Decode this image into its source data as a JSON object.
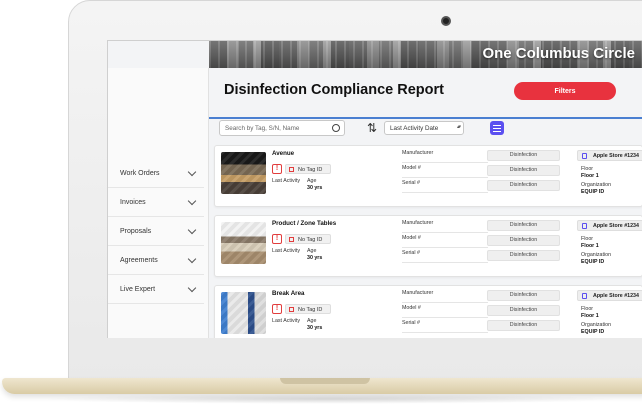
{
  "banner": {
    "title": "One Columbus Circle"
  },
  "sidebar": {
    "items": [
      {
        "label": "Work Orders"
      },
      {
        "label": "Invoices"
      },
      {
        "label": "Proposals"
      },
      {
        "label": "Agreements"
      },
      {
        "label": "Live Expert"
      }
    ]
  },
  "header": {
    "title": "Disinfection Compliance Report",
    "filters_label": "Filters"
  },
  "toolbar": {
    "search_placeholder": "Search by Tag, S/N, Name",
    "sort_value": "Last Activity Date"
  },
  "card_labels": {
    "no_tag": "No Tag ID",
    "last_activity": "Last Activity",
    "age": "Age",
    "manufacturer": "Manufacturer",
    "model": "Model #",
    "serial": "Serial #",
    "disinfection": "Disinfection",
    "floor": "Floor",
    "organization": "Organization"
  },
  "assets": [
    {
      "name": "Avenue",
      "age": "30 yrs",
      "store": "Apple Store #1234",
      "floor": "Floor 1",
      "org": "EQUIP ID"
    },
    {
      "name": "Product / Zone Tables",
      "age": "30 yrs",
      "store": "Apple Store #1234",
      "floor": "Floor 1",
      "org": "EQUIP ID"
    },
    {
      "name": "Break Area",
      "age": "30 yrs",
      "store": "Apple Store #1234",
      "floor": "Floor 1",
      "org": "EQUIP ID"
    }
  ],
  "colors": {
    "accent_red": "#e8323e",
    "accent_purple": "#5b4ff0",
    "divider_blue": "#4a7fd1"
  },
  "icons": [
    "search-icon",
    "sort-icon",
    "tune-icon",
    "alert-icon",
    "tag-icon",
    "store-icon",
    "chevron-down-icon"
  ]
}
